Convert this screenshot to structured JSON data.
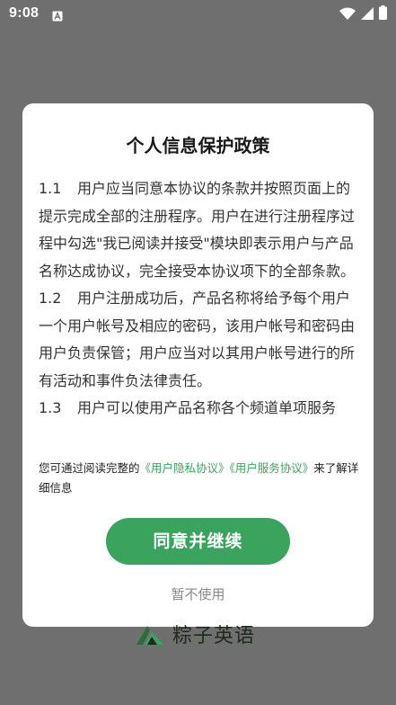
{
  "status_bar": {
    "time": "9:08",
    "icons": [
      "notification-a-icon",
      "wifi-icon",
      "cell-signal-icon",
      "battery-icon"
    ]
  },
  "dialog": {
    "title": "个人信息保护政策",
    "paragraphs": [
      {
        "num": "1.1",
        "text": "用户应当同意本协议的条款并按照页面上的提示完成全部的注册程序。用户在进行注册程序过程中勾选\"我已阅读并接受\"模块即表示用户与产品名称达成协议，完全接受本协议项下的全部条款。"
      },
      {
        "num": "1.2",
        "text": "用户注册成功后，产品名称将给予每个用户一个用户帐号及相应的密码，该用户帐号和密码由用户负责保管；用户应当对以其用户帐号进行的所有活动和事件负法律责任。"
      },
      {
        "num": "1.3",
        "text": "用户可以使用产品名称各个频道单项服务"
      }
    ],
    "notice_prefix": "您可通过阅读完整的",
    "privacy_link": "《用户隐私协议》",
    "service_link": "《用户服务协议》",
    "notice_suffix": "来了解详细信息",
    "agree_label": "同意并继续",
    "decline_label": "暂不使用"
  },
  "brand": {
    "name": "粽子英语"
  },
  "colors": {
    "accent": "#3aa35e",
    "overlay": "#6f6f6f",
    "text": "#333333",
    "muted": "#888888"
  }
}
